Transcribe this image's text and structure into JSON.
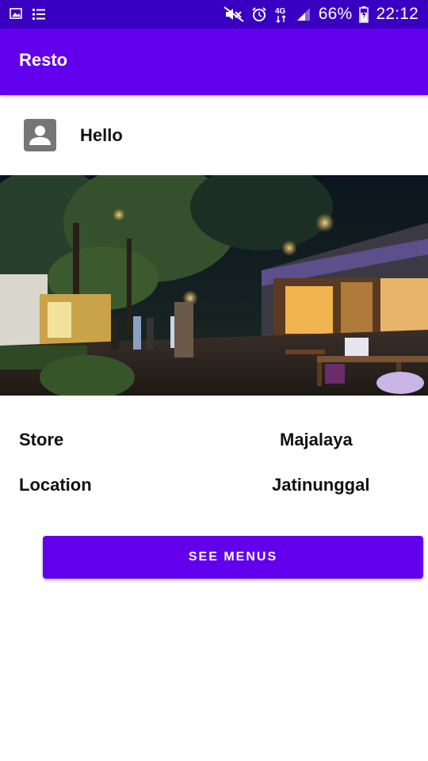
{
  "status_bar": {
    "battery": "66%",
    "time": "22:12",
    "network": "4G",
    "left_icons": [
      "image-icon",
      "list-icon"
    ],
    "right_icons": [
      "mute-icon",
      "alarm-icon",
      "network-4g-icon",
      "signal-icon",
      "battery-icon"
    ]
  },
  "app_bar": {
    "title": "Resto",
    "color": "#6200ee"
  },
  "profile": {
    "icon": "account-box-icon",
    "greeting": "Hello"
  },
  "hero_image": {
    "description": "Restaurant patio at night"
  },
  "info": {
    "store_label": "Store",
    "store_value": "Majalaya",
    "location_label": "Location",
    "location_value": "Jatinunggal"
  },
  "actions": {
    "see_menus_label": "SEE MENUS"
  },
  "colors": {
    "status_bar": "#3a00c2",
    "primary": "#6200ee"
  }
}
